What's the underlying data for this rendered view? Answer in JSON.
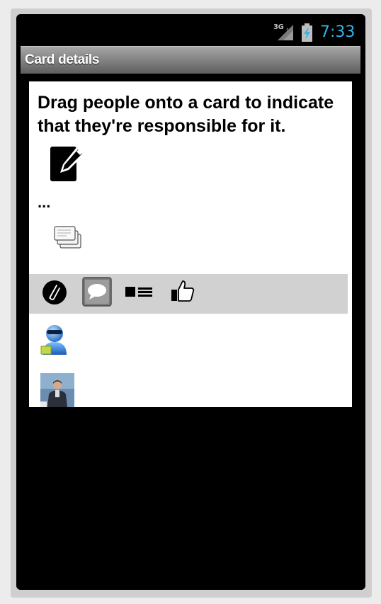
{
  "status_bar": {
    "network": "3G",
    "time": "7:33",
    "time_color": "#33b5e5"
  },
  "action_bar": {
    "title": "Card details"
  },
  "content": {
    "instruction": "Drag people onto a card to indicate that they're responsible for it.",
    "edit_icon": "edit-pencil-icon",
    "ellipsis": "...",
    "stack_icon": "card-stack-icon"
  },
  "toolbar": {
    "icons": [
      "attachment-icon",
      "comment-icon",
      "list-icon",
      "like-icon"
    ]
  },
  "people": [
    {
      "icon": "generic-user-icon"
    },
    {
      "icon": "user-photo"
    }
  ]
}
